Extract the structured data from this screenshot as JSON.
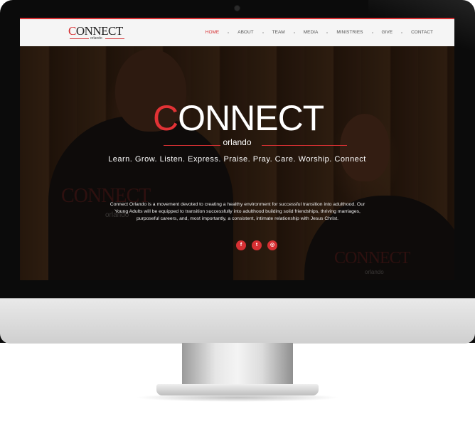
{
  "logo": {
    "c": "C",
    "rest": "ONNECT",
    "sub": "orlando"
  },
  "nav": {
    "items": [
      {
        "label": "HOME",
        "active": true
      },
      {
        "label": "ABOUT"
      },
      {
        "label": "TEAM"
      },
      {
        "label": "MEDIA"
      },
      {
        "label": "MINISTRIES"
      },
      {
        "label": "GIVE"
      },
      {
        "label": "CONTACT"
      }
    ]
  },
  "hero": {
    "logo_c": "C",
    "logo_rest": "ONNECT",
    "logo_sub": "orlando",
    "tagline": "Learn. Grow. Listen. Express. Praise. Pray. Care. Worship. Connect",
    "description": "Connect Orlando is a movement devoted to creating a healthy environment for successful transition into adulthood. Our Young Adults will be equipped to transition successfully into adulthood building solid friendships, thriving marriages, purposeful careers, and, most importantly, a consistent, intimate relationship with Jesus Christ."
  },
  "shirt": {
    "word1": "CONNECT",
    "sub1": "orlando",
    "word2": "CONNECT",
    "sub2": "orlando"
  },
  "social": [
    {
      "icon": "facebook-icon",
      "glyph": "f"
    },
    {
      "icon": "twitter-icon",
      "glyph": "t"
    },
    {
      "icon": "instagram-icon",
      "glyph": "◎"
    }
  ],
  "colors": {
    "accent": "#d63033",
    "navbar": "#f5f5f5"
  }
}
